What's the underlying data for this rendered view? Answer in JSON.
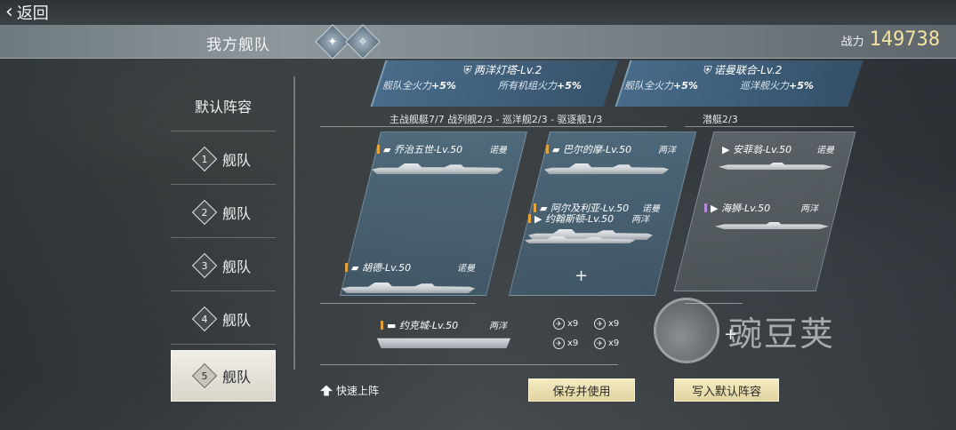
{
  "header": {
    "back_label": "返回",
    "title": "我方舰队",
    "power_label": "战力",
    "power_value": "149738"
  },
  "sidebar": {
    "items": [
      {
        "label": "默认阵容",
        "num": ""
      },
      {
        "label": "舰队",
        "num": "1"
      },
      {
        "label": "舰队",
        "num": "2"
      },
      {
        "label": "舰队",
        "num": "3"
      },
      {
        "label": "舰队",
        "num": "4"
      },
      {
        "label": "舰队",
        "num": "5"
      }
    ],
    "active_index": 5
  },
  "buffs": [
    {
      "title": "两洋灯塔-Lv.2",
      "effect1_label": "舰队全火力",
      "effect1_value": "+5%",
      "effect2_label": "所有机组火力",
      "effect2_value": "+5%"
    },
    {
      "title": "诺曼联合-Lv.2",
      "effect1_label": "舰队全火力",
      "effect1_value": "+5%",
      "effect2_label": "巡洋舰火力",
      "effect2_value": "+5%"
    }
  ],
  "fleet_summary": "主战舰艇7/7    战列舰2/3 - 巡洋舰2/3 - 驱逐舰1/3",
  "submarine_summary": "潜艇2/3",
  "ships": [
    {
      "name": "乔治五世-Lv.50",
      "faction": "诺曼",
      "rank": "orange"
    },
    {
      "name": "胡德-Lv.50",
      "faction": "诺曼",
      "rank": "orange"
    },
    {
      "name": "巴尔的摩-Lv.50",
      "faction": "两洋",
      "rank": "orange"
    },
    {
      "name": "阿尔及利亚-Lv.50",
      "faction": "诺曼",
      "rank": "orange"
    },
    {
      "name": "约翰斯顿-Lv.50",
      "faction": "两洋",
      "rank": "orange"
    },
    {
      "name": "安菲翁-Lv.50",
      "faction": "诺曼",
      "rank": "orange"
    },
    {
      "name": "海狮-Lv.50",
      "faction": "两洋",
      "rank": "purple"
    },
    {
      "name": "约克城-Lv.50",
      "faction": "两洋",
      "rank": "orange"
    }
  ],
  "aircraft": [
    {
      "count": "x9"
    },
    {
      "count": "x9"
    },
    {
      "count": "x9"
    },
    {
      "count": "x9"
    }
  ],
  "plus_symbol": "+",
  "footer": {
    "quick_deploy": "快速上阵",
    "save_use": "保存并使用",
    "write_default": "写入默认阵容"
  },
  "watermark": "豌豆荚",
  "colors": {
    "power": "#f3e2a0",
    "button": "#e8dcae",
    "panel": "#5f8caa"
  }
}
